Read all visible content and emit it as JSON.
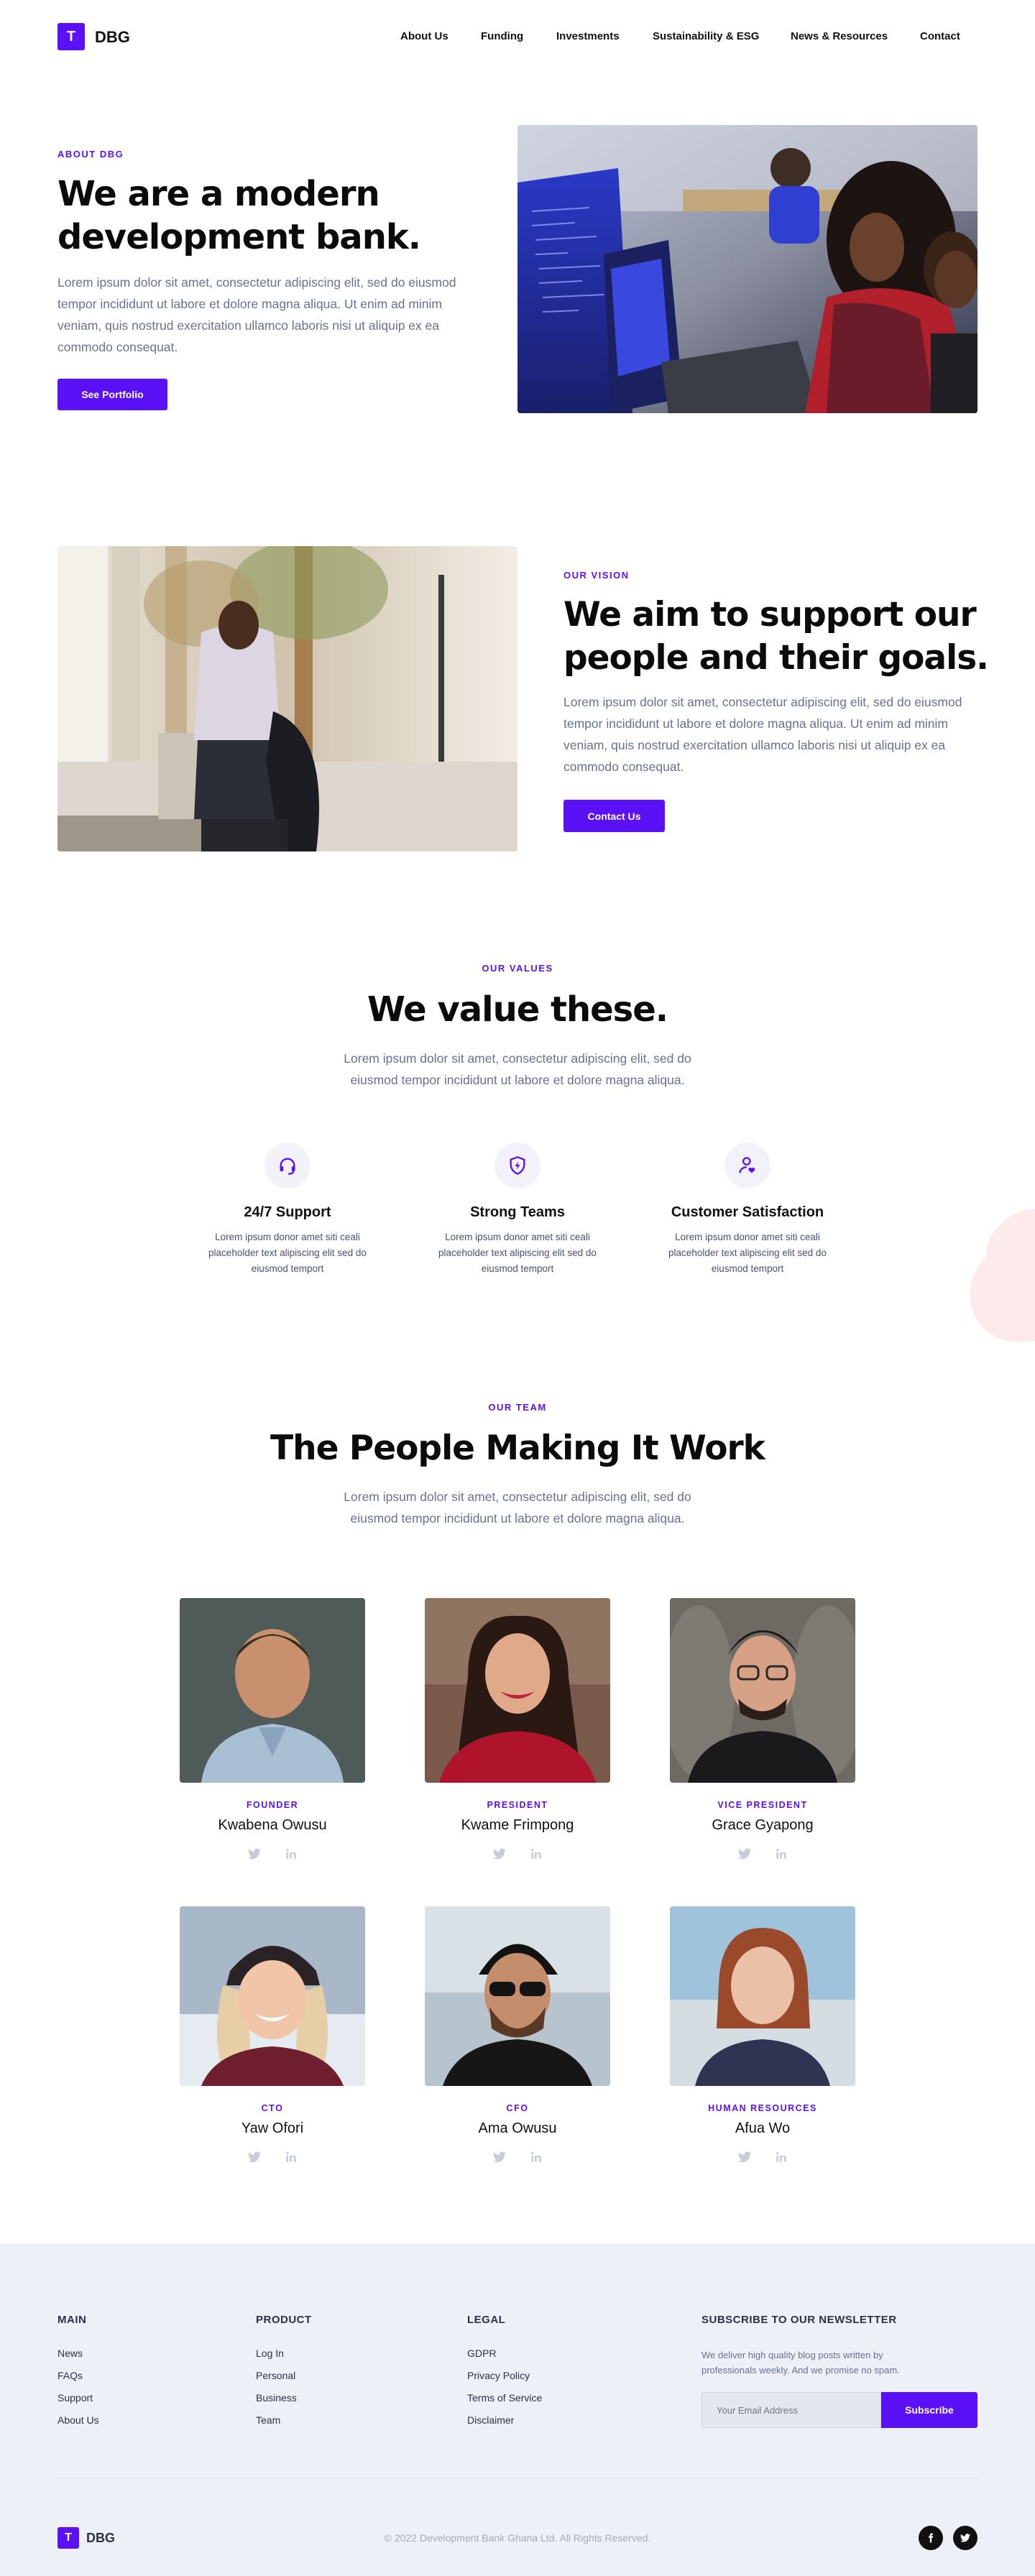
{
  "header": {
    "logo_letter": "T",
    "logo_text": "DBG",
    "nav": [
      "About Us",
      "Funding",
      "Investments",
      "Sustainability & ESG",
      "News & Resources",
      "Contact"
    ]
  },
  "hero": {
    "eyebrow": "ABOUT DBG",
    "title_line1": "We are a modern",
    "title_line2": "development bank.",
    "body": "Lorem ipsum dolor sit amet, consectetur adipiscing elit, sed do eiusmod tempor incididunt ut labore et dolore magna aliqua. Ut enim ad minim veniam, quis nostrud exercitation ullamco laboris nisi ut aliquip ex ea commodo consequat.",
    "button": "See Portfolio"
  },
  "vision": {
    "eyebrow": "OUR VISION",
    "title_line1": "We aim to support our",
    "title_line2": "people and their goals.",
    "body": "Lorem ipsum dolor sit amet, consectetur adipiscing elit, sed do eiusmod tempor incididunt ut labore et dolore magna aliqua. Ut enim ad minim veniam, quis nostrud exercitation ullamco laboris nisi ut aliquip ex ea commodo consequat.",
    "button": "Contact Us"
  },
  "values": {
    "eyebrow": "OUR VALUES",
    "title": "We value these.",
    "body_line1": "Lorem ipsum dolor sit amet, consectetur adipiscing elit, sed do",
    "body_line2": "eiusmod tempor incididunt ut labore et dolore magna aliqua.",
    "items": [
      {
        "title": "24/7 Support",
        "icon": "headset-icon",
        "text_line1": "Lorem ipsum donor amet siti ceali",
        "text_line2": "placeholder text alipiscing elit sed do",
        "text_line3": "eiusmod temport"
      },
      {
        "title": "Strong Teams",
        "icon": "shield-icon",
        "text_line1": "Lorem ipsum donor amet siti ceali",
        "text_line2": "placeholder text alipiscing elit sed do",
        "text_line3": "eiusmod temport"
      },
      {
        "title": "Customer Satisfaction",
        "icon": "user-heart-icon",
        "text_line1": "Lorem ipsum donor amet siti ceali",
        "text_line2": "placeholder text alipiscing elit sed do",
        "text_line3": "eiusmod temport"
      }
    ]
  },
  "team": {
    "eyebrow": "OUR TEAM",
    "title": "The People Making It Work",
    "body_line1": "Lorem ipsum dolor sit amet, consectetur adipiscing elit, sed do",
    "body_line2": "eiusmod tempor incididunt ut labore et dolore magna aliqua.",
    "members": [
      {
        "role": "FOUNDER",
        "name": "Kwabena Owusu"
      },
      {
        "role": "PRESIDENT",
        "name": "Kwame Frimpong"
      },
      {
        "role": "VICE PRESIDENT",
        "name": "Grace Gyapong"
      },
      {
        "role": "CTO",
        "name": "Yaw Ofori"
      },
      {
        "role": "CFO",
        "name": "Ama Owusu"
      },
      {
        "role": "HUMAN RESOURCES",
        "name": "Afua Wo"
      }
    ]
  },
  "footer": {
    "columns": [
      {
        "heading": "MAIN",
        "links": [
          "News",
          "FAQs",
          "Support",
          "About Us"
        ]
      },
      {
        "heading": "PRODUCT",
        "links": [
          "Log In",
          "Personal",
          "Business",
          "Team"
        ]
      },
      {
        "heading": "LEGAL",
        "links": [
          "GDPR",
          "Privacy Policy",
          "Terms of Service",
          "Disclaimer"
        ]
      }
    ],
    "newsletter": {
      "heading": "SUBSCRIBE TO OUR NEWSLETTER",
      "text_line1": "We deliver high quality blog posts written by",
      "text_line2": "professionals weekly. And we promise no spam.",
      "placeholder": "Your Email Address",
      "button": "Subscribe"
    },
    "logo_letter": "T",
    "logo_text": "DBG",
    "copyright": "© 2022 Development Bank Ghana Ltd. All Rights Reserved."
  },
  "colors": {
    "accent": "#5b11f5",
    "muted_text": "#6b6f94",
    "footer_bg": "#edf0f6",
    "blob": "#fdeaea"
  }
}
